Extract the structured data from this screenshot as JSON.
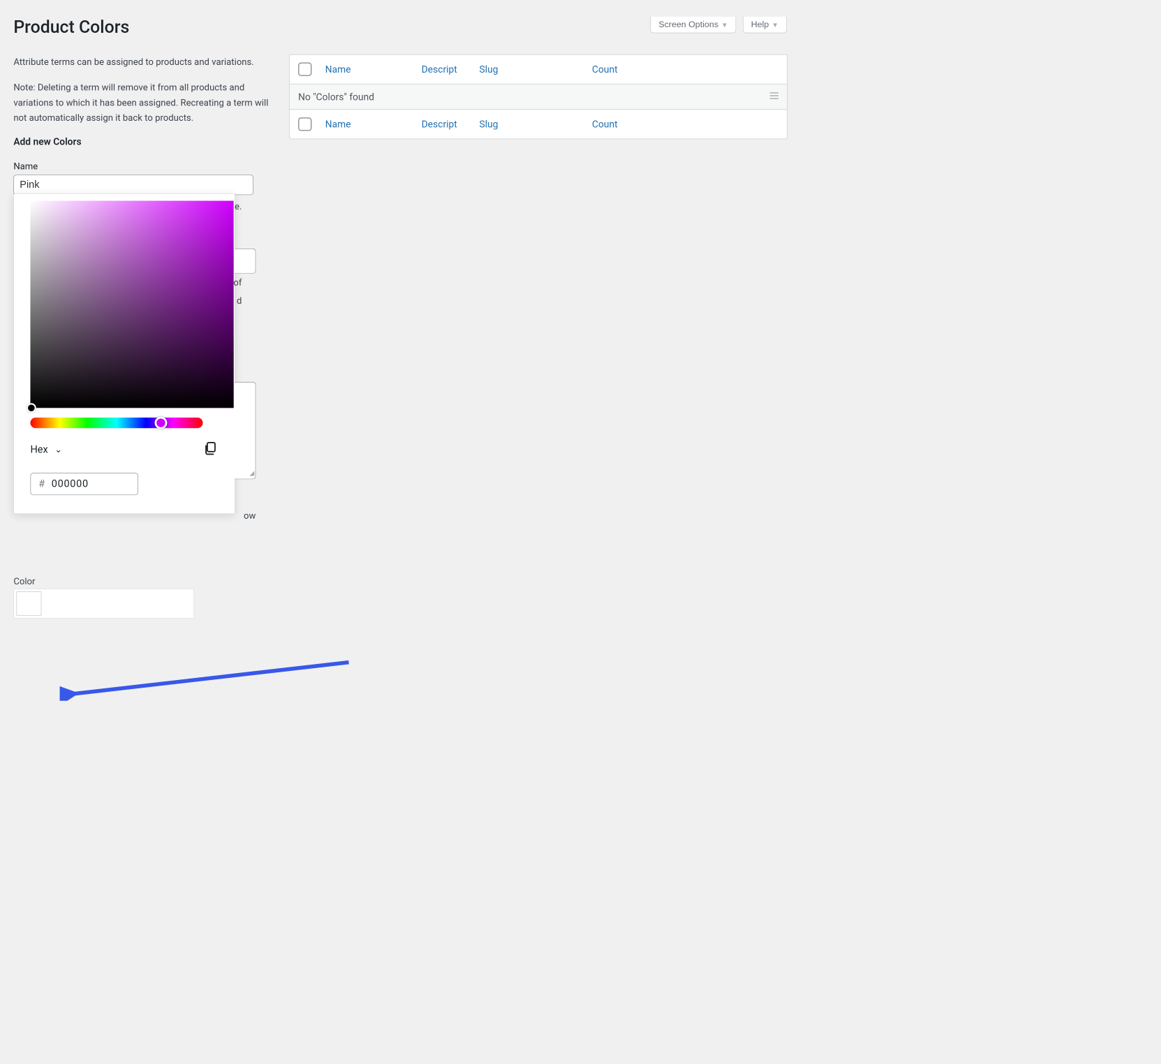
{
  "top_buttons": {
    "screen_options": "Screen Options",
    "help": "Help"
  },
  "page_title": "Product Colors",
  "intro": {
    "p1": "Attribute terms can be assigned to products and variations.",
    "p2": "Note: Deleting a term will remove it from all products and variations to which it has been assigned. Recreating a term will not automatically assign it back to products."
  },
  "add_new_heading": "Add new Colors",
  "form": {
    "name_label": "Name",
    "name_value": "Pink",
    "color_label": "Color"
  },
  "peek_text": {
    "e": "e.",
    "of": "of",
    "d": "d",
    "ow": "ow"
  },
  "picker": {
    "format_label": "Hex",
    "hash": "#",
    "hex_value": "000000"
  },
  "table": {
    "columns": {
      "name": "Name",
      "description": "Descript",
      "slug": "Slug",
      "count": "Count"
    },
    "empty_message": "No \"Colors\" found"
  }
}
